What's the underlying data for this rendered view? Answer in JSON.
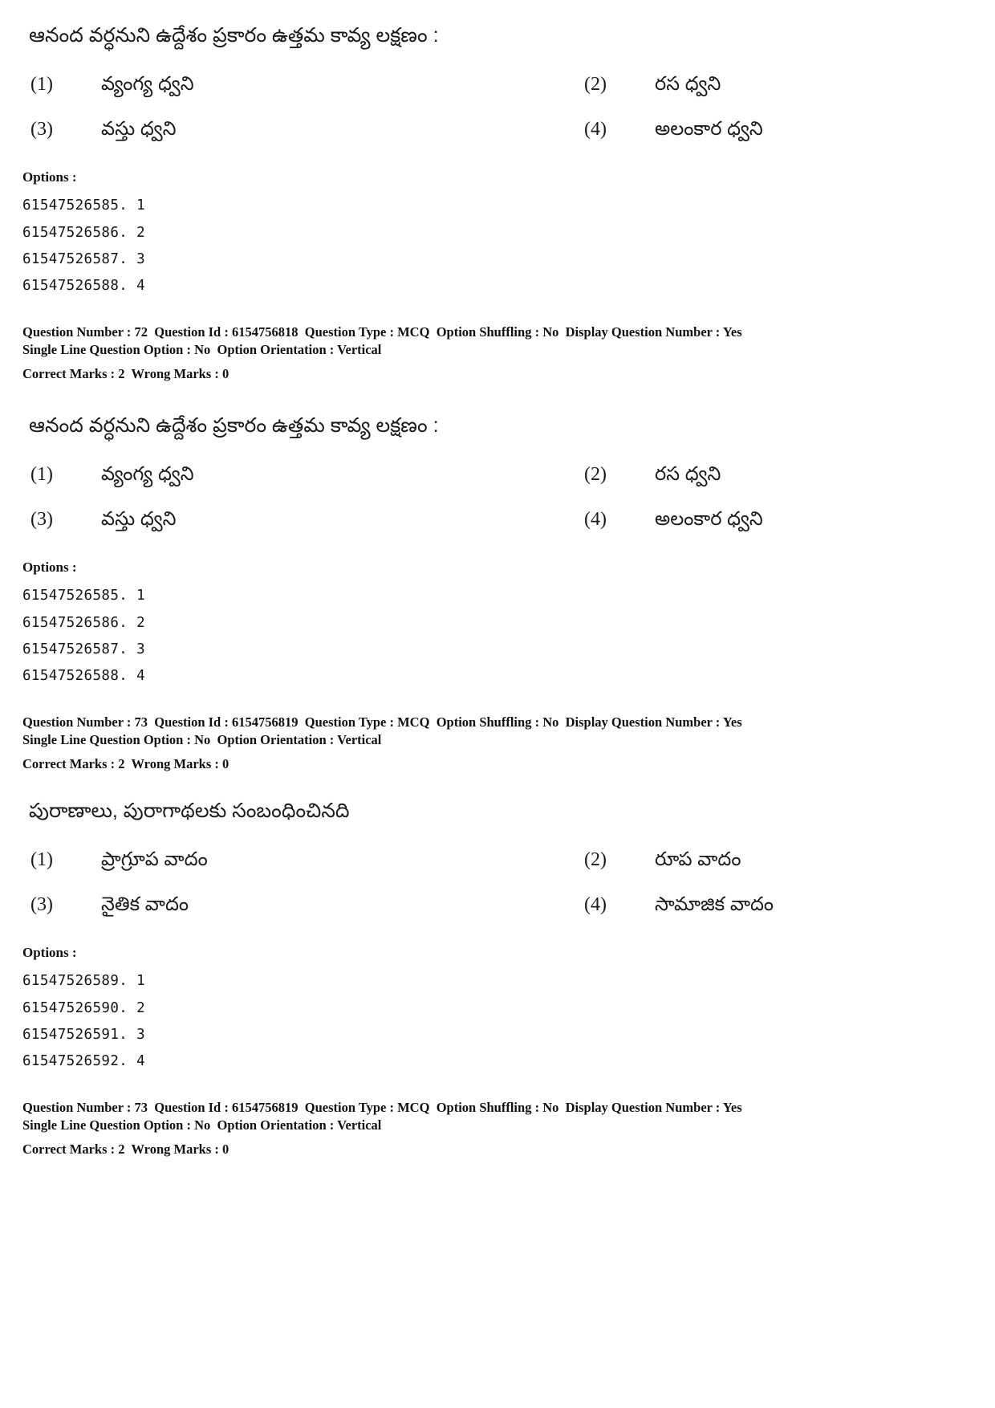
{
  "page": {
    "labels": {
      "options_heading": "Options :",
      "question_number": "Question Number :",
      "question_id": "Question Id :",
      "question_type": "Question Type :",
      "option_shuffling": "Option Shuffling :",
      "display_question_number": "Display Question Number :",
      "single_line_question_option": "Single Line Question Option :",
      "option_orientation": "Option Orientation :",
      "correct_marks": "Correct Marks :",
      "wrong_marks": "Wrong Marks :"
    }
  },
  "blocks": [
    {
      "stem": "ఆనంద వర్ధనుని ఉద్దేశం ప్రకారం ఉత్తమ కావ్య లక్షణం :",
      "choices": [
        {
          "num": "(1)",
          "text": "వ్యంగ్య ధ్వని"
        },
        {
          "num": "(2)",
          "text": "రస ధ్వని"
        },
        {
          "num": "(3)",
          "text": "వస్తు ధ్వని"
        },
        {
          "num": "(4)",
          "text": "అలంకార ధ్వని"
        }
      ],
      "option_ids": [
        "61547526585. 1",
        "61547526586. 2",
        "61547526587. 3",
        "61547526588. 4"
      ],
      "meta": {
        "question_number": "72",
        "question_id": "6154756818",
        "question_type": "MCQ",
        "option_shuffling": "No",
        "display_question_number": "Yes",
        "single_line_question_option": "No",
        "option_orientation": "Vertical",
        "correct_marks": "2",
        "wrong_marks": "0"
      }
    },
    {
      "stem": "ఆనంద వర్ధనుని ఉద్దేశం ప్రకారం ఉత్తమ కావ్య లక్షణం :",
      "choices": [
        {
          "num": "(1)",
          "text": "వ్యంగ్య ధ్వని"
        },
        {
          "num": "(2)",
          "text": "రస ధ్వని"
        },
        {
          "num": "(3)",
          "text": "వస్తు ధ్వని"
        },
        {
          "num": "(4)",
          "text": "అలంకార ధ్వని"
        }
      ],
      "option_ids": [
        "61547526585. 1",
        "61547526586. 2",
        "61547526587. 3",
        "61547526588. 4"
      ],
      "meta": {
        "question_number": "73",
        "question_id": "6154756819",
        "question_type": "MCQ",
        "option_shuffling": "No",
        "display_question_number": "Yes",
        "single_line_question_option": "No",
        "option_orientation": "Vertical",
        "correct_marks": "2",
        "wrong_marks": "0"
      }
    },
    {
      "stem": "పురాణాలు, పురాగాథలకు సంబంధించినది",
      "choices": [
        {
          "num": "(1)",
          "text": "ప్రాగ్రూప వాదం"
        },
        {
          "num": "(2)",
          "text": "రూప వాదం"
        },
        {
          "num": "(3)",
          "text": "నైతిక వాదం"
        },
        {
          "num": "(4)",
          "text": "సామాజిక వాదం"
        }
      ],
      "option_ids": [
        "61547526589. 1",
        "61547526590. 2",
        "61547526591. 3",
        "61547526592. 4"
      ],
      "meta": {
        "question_number": "73",
        "question_id": "6154756819",
        "question_type": "MCQ",
        "option_shuffling": "No",
        "display_question_number": "Yes",
        "single_line_question_option": "No",
        "option_orientation": "Vertical",
        "correct_marks": "2",
        "wrong_marks": "0"
      }
    }
  ]
}
